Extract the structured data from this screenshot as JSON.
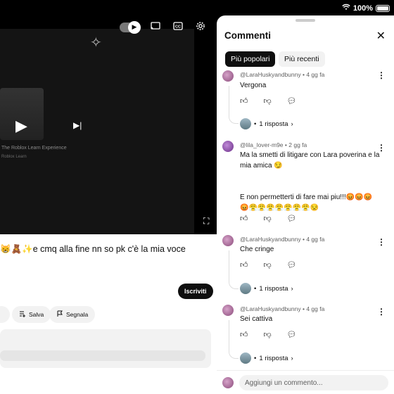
{
  "status": {
    "battery": "100%"
  },
  "video": {
    "thumb_title": "The Roblox Learn Experience",
    "thumb_sub": "Roblox Learn"
  },
  "page": {
    "title": "😸🧸✨e cmq alla fine nn so pk c'è la mia voce",
    "subscribe_label": "Iscriviti",
    "chips": [
      {
        "label": "Salva",
        "icon": "save-icon"
      },
      {
        "label": "Segnala",
        "icon": "flag-icon"
      }
    ]
  },
  "panel": {
    "title": "Commenti",
    "tabs": [
      "Più popolari",
      "Più recenti"
    ],
    "comments": [
      {
        "author": "@LaraHuskyandbunny",
        "time": "4 gg fa",
        "text": "Vergona",
        "replies": "1 risposta"
      },
      {
        "author": "@lila_lover-m9e",
        "time": "2 gg fa",
        "text": "Ma la smetti di litigare con Lara  poverina e la mia amica 😏\n\n\nE non permetterti di fare mai piu!!!😡😡😡\n😡😤😤😤😤😤😤😤😒",
        "replies": ""
      },
      {
        "author": "@LaraHuskyandbunny",
        "time": "4 gg fa",
        "text": "Che cringe",
        "replies": "1 risposta"
      },
      {
        "author": "@LaraHuskyandbunny",
        "time": "4 gg fa",
        "text": "Sei cattiva",
        "replies": "1 risposta"
      }
    ],
    "add_placeholder": "Aggiungi un commento..."
  }
}
